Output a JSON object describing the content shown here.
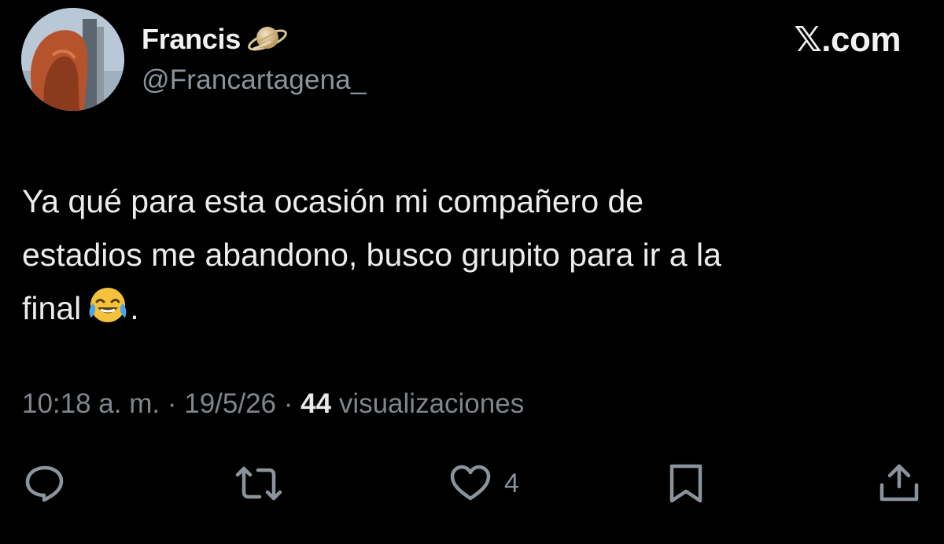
{
  "author": {
    "display_name": "Francis",
    "handle": "@Francartagena_",
    "badge_icon": "planet-ringed-icon"
  },
  "site": "𝕏.com",
  "tweet": {
    "lines": [
      "Ya qué para esta ocasión mi compañero de",
      "estadios me abandono, busco grupito para ir a la",
      "final"
    ],
    "trailing_emoji_icon": "face-with-tears-of-joy-icon",
    "trailing_text": "."
  },
  "meta": {
    "time": "10:18 a. m.",
    "separator": "·",
    "date": "19/5/26",
    "views_count": "44",
    "views_label": "visualizaciones"
  },
  "actions": {
    "reply_icon": "reply-bubble-icon",
    "repost_icon": "repost-icon",
    "like_icon": "heart-icon",
    "like_count": "4",
    "bookmark_icon": "bookmark-icon",
    "share_icon": "share-icon"
  },
  "colors": {
    "background": "#000000",
    "text_primary": "#e7e9ea",
    "text_secondary": "#8b949c"
  }
}
